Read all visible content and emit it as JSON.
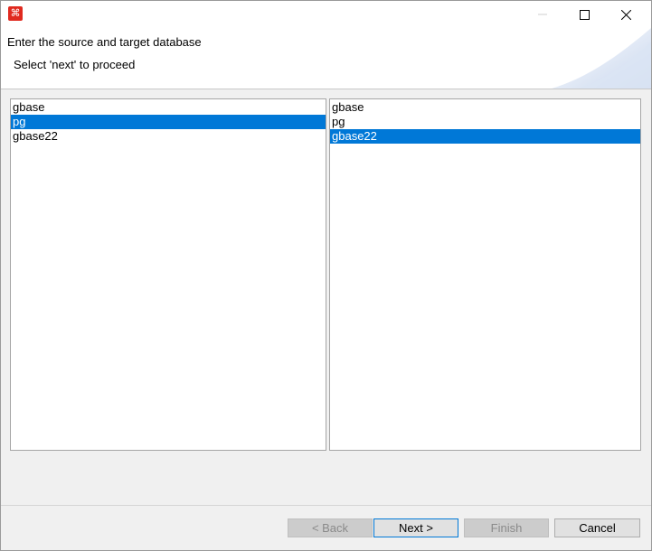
{
  "titlebar": {
    "app_icon_glyph": "⌘",
    "icons": {
      "app": "app-logo-icon",
      "minimize": "minimize-icon",
      "maximize": "maximize-icon",
      "close": "close-icon"
    }
  },
  "header": {
    "title": "Enter the source and target database",
    "subtitle": "Select 'next' to proceed"
  },
  "source_list": {
    "items": [
      "gbase",
      "pg",
      "gbase22"
    ],
    "selected": "pg"
  },
  "target_list": {
    "items": [
      "gbase",
      "pg",
      "gbase22"
    ],
    "selected": "gbase22"
  },
  "buttons": {
    "back": "< Back",
    "next": "Next >",
    "finish": "Finish",
    "cancel": "Cancel"
  },
  "colors": {
    "selection": "#0078d7",
    "app_icon": "#e02a1f"
  }
}
